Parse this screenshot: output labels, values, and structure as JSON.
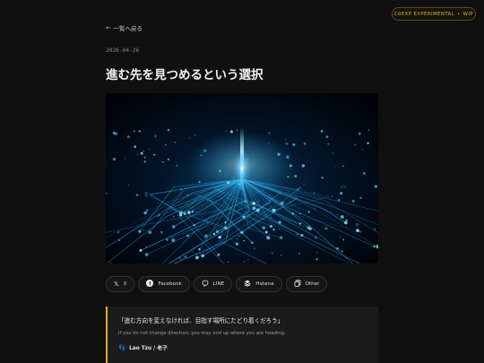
{
  "badge": {
    "label": "CōEXP EXPERIMENTAL",
    "sep": "•",
    "status": "WIP"
  },
  "nav": {
    "back_label": "一覧へ戻る"
  },
  "article": {
    "date": "2026-04-26",
    "title": "進む先を見つめるという選択"
  },
  "share": [
    {
      "icon": "x-icon",
      "label": "X"
    },
    {
      "icon": "facebook-icon",
      "label": "Facebook"
    },
    {
      "icon": "line-icon",
      "label": "LINE"
    },
    {
      "icon": "hatena-icon",
      "label": "Hatena"
    },
    {
      "icon": "copy-icon",
      "label": "Other"
    }
  ],
  "quote": {
    "ja": "「進む方向を変えなければ、目指す場所にたどり着くだろう」",
    "en": "If you do not change direction, you may end up where you are heading.",
    "author": "Lao Tzu / 老子"
  },
  "colors": {
    "accent": "#e0b02e",
    "background": "#101010",
    "glow": "#3fc8ff"
  }
}
